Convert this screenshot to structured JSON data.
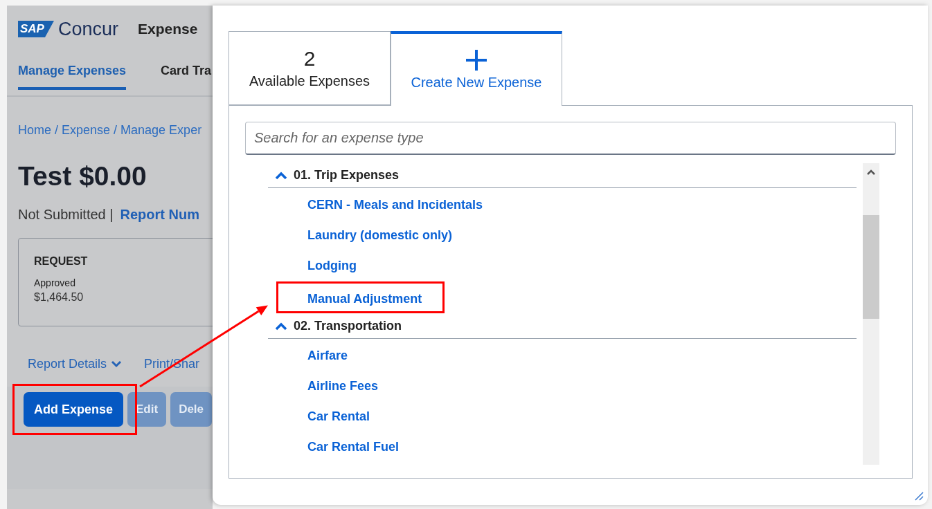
{
  "app": {
    "logo_mark": "SAP",
    "logo_name": "Concur",
    "product": "Expense"
  },
  "nav_tabs": [
    {
      "label": "Manage Expenses",
      "selected": true
    },
    {
      "label": "Card Tra",
      "selected": false
    }
  ],
  "breadcrumb": "Home / Expense / Manage Exper",
  "report": {
    "title": "Test $0.00",
    "status": "Not Submitted |",
    "report_number_link": "Report Num"
  },
  "request_card": {
    "heading": "REQUEST",
    "status": "Approved",
    "amount": "$1,464.50"
  },
  "links": [
    {
      "label": "Report Details",
      "kind": "dropdown"
    },
    {
      "label": "Print/Shar",
      "kind": "plain"
    }
  ],
  "actions": [
    {
      "label": "Add Expense",
      "disabled": false,
      "highlighted": true
    },
    {
      "label": "Edit",
      "disabled": true,
      "highlighted": false
    },
    {
      "label": "Dele",
      "disabled": true,
      "highlighted": false
    }
  ],
  "dialog": {
    "tabs": [
      {
        "kind": "count",
        "count": "2",
        "label": "Available Expenses",
        "selected": false
      },
      {
        "kind": "icon",
        "label": "Create New Expense",
        "selected": true
      }
    ],
    "search": {
      "placeholder": "Search for an expense type"
    },
    "groups": [
      {
        "label": "01. Trip Expenses",
        "expanded": true,
        "items": [
          {
            "label": "CERN - Meals and Incidentals",
            "highlighted": false
          },
          {
            "label": "Laundry (domestic only)",
            "highlighted": false
          },
          {
            "label": "Lodging",
            "highlighted": false
          },
          {
            "label": "Manual Adjustment",
            "highlighted": true
          }
        ]
      },
      {
        "label": "02. Transportation",
        "expanded": true,
        "items": [
          {
            "label": "Airfare",
            "highlighted": false
          },
          {
            "label": "Airline Fees",
            "highlighted": false
          },
          {
            "label": "Car Rental",
            "highlighted": false
          },
          {
            "label": "Car Rental Fuel",
            "highlighted": false
          }
        ]
      }
    ]
  }
}
